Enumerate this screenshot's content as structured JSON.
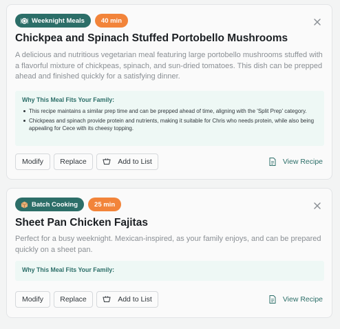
{
  "meals": [
    {
      "category": "Weeknight Meals",
      "category_icon": "plate-icon",
      "time": "40 min",
      "title": "Chickpea and Spinach Stuffed Portobello Mushrooms",
      "description": "A delicious and nutritious vegetarian meal featuring large portobello mushrooms stuffed with a flavorful mixture of chickpeas, spinach, and sun-dried tomatoes. This dish can be prepped ahead and finished quickly for a satisfying dinner.",
      "why_title": "Why This Meal Fits Your Family:",
      "why_points": [
        "This recipe maintains a similar prep time and can be prepped ahead of time, aligning with the 'Split Prep' category.",
        "Chickpeas and spinach provide protein and nutrients, making it suitable for Chris who needs protein, while also being appealing for Cece with its cheesy topping."
      ],
      "actions": {
        "modify": "Modify",
        "replace": "Replace",
        "add_to_list": "Add to List",
        "view_recipe": "View Recipe"
      }
    },
    {
      "category": "Batch Cooking",
      "category_icon": "box-icon",
      "time": "25 min",
      "title": "Sheet Pan Chicken Fajitas",
      "description": "Perfect for a busy weeknight. Mexican-inspired, as your family enjoys, and can be prepared quickly on a sheet pan.",
      "why_title": "Why This Meal Fits Your Family:",
      "why_points": [],
      "actions": {
        "modify": "Modify",
        "replace": "Replace",
        "add_to_list": "Add to List",
        "view_recipe": "View Recipe"
      }
    }
  ],
  "colors": {
    "accent": "#2c6e68",
    "time_badge": "#f2843a",
    "why_bg": "#eef8f5"
  }
}
